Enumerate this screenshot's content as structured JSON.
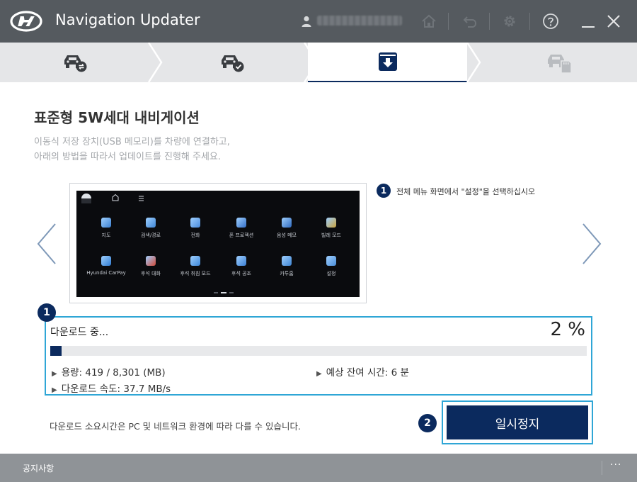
{
  "window": {
    "title": "Navigation Updater",
    "user_name": "",
    "controls": [
      "home-icon",
      "undo-icon",
      "gear-icon",
      "help-icon",
      "minimize-icon",
      "close-icon"
    ]
  },
  "steps": [
    {
      "icon": "car-sync-icon",
      "state": "done"
    },
    {
      "icon": "car-check-icon",
      "state": "done"
    },
    {
      "icon": "download-box-icon",
      "state": "active"
    },
    {
      "icon": "car-sd-card-icon",
      "state": "pending"
    }
  ],
  "main": {
    "title": "표준형 5W세대 내비게이션",
    "desc_line1": "이동식 저장 장치(USB 메모리)를 차량에 연결하고,",
    "desc_line2": "아래의 방법을 따라서 업데이트를 진행해 주세요."
  },
  "guide": {
    "step_number": "1",
    "caption": "전체 메뉴 화면에서 \"설정\"을 선택하십시오",
    "apps": [
      {
        "label": "지도",
        "color": "#3a7fd0"
      },
      {
        "label": "검색/경로",
        "color": "#3f86d6"
      },
      {
        "label": "전화",
        "color": "#4a8bdc"
      },
      {
        "label": "폰 프로젝션",
        "color": "#3570c9"
      },
      {
        "label": "음성 메모",
        "color": "#2f6ac0"
      },
      {
        "label": "빌레 모드",
        "color": "#c9a23d"
      },
      {
        "label": "Hyundai CarPay",
        "color": "#2f7bd1"
      },
      {
        "label": "후석 대화",
        "color": "#d04a3a"
      },
      {
        "label": "후석 취침 모드",
        "color": "#3b86d8"
      },
      {
        "label": "후석 공조",
        "color": "#3b7fd4"
      },
      {
        "label": "카투홈",
        "color": "#3d84d2"
      },
      {
        "label": "설정",
        "color": "#4a8dd8"
      }
    ]
  },
  "download": {
    "box_number": "1",
    "status": "다운로드 중...",
    "percent_text": "2 %",
    "progress": 0.02,
    "capacity": "용량: 419 / 8,301 (MB)",
    "remaining": "예상 잔여 시간: 6 분",
    "speed": "다운로드 속도: 37.7 MB/s"
  },
  "note": "다운로드 소요시간은 PC 및 네트워크 환경에 따라 다를 수 있습니다.",
  "pause": {
    "number": "2",
    "label": "일시정지"
  },
  "footer": {
    "notice": "공지사항",
    "more": "···"
  },
  "colors": {
    "titlebar": "#555a5f",
    "accent_navy": "#0b2a5e",
    "highlight_blue": "#2fa6d6",
    "footer": "#8f9397"
  }
}
